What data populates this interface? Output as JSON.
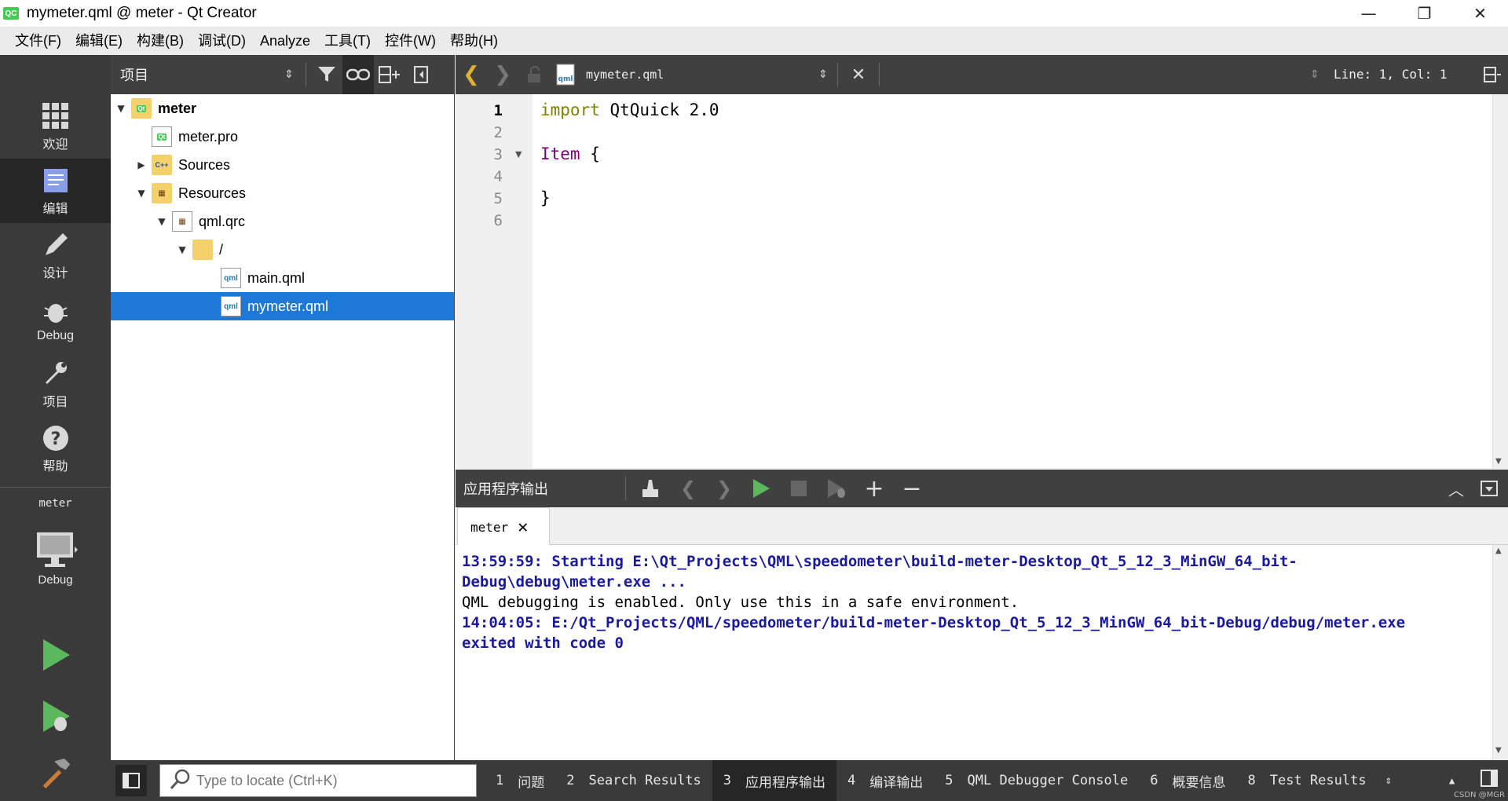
{
  "window": {
    "app_icon_text": "QC",
    "title": "mymeter.qml @ meter - Qt Creator",
    "minimize": "—",
    "restore": "❐",
    "close": "✕"
  },
  "menu": [
    "文件(F)",
    "编辑(E)",
    "构建(B)",
    "调试(D)",
    "Analyze",
    "工具(T)",
    "控件(W)",
    "帮助(H)"
  ],
  "modes": {
    "welcome": "欢迎",
    "edit": "编辑",
    "design": "设计",
    "debug": "Debug",
    "projects": "项目",
    "help": "帮助",
    "kit_name": "meter",
    "kit_mode": "Debug"
  },
  "project_panel": {
    "combo": "项目",
    "tree": [
      {
        "label": "meter",
        "bold": true
      },
      {
        "label": "meter.pro"
      },
      {
        "label": "Sources"
      },
      {
        "label": "Resources"
      },
      {
        "label": "qml.qrc"
      },
      {
        "label": "/"
      },
      {
        "label": "main.qml"
      },
      {
        "label": "mymeter.qml",
        "selected": true
      }
    ]
  },
  "editor": {
    "filename": "mymeter.qml",
    "position": "Line: 1, Col: 1",
    "line_numbers": [
      "1",
      "2",
      "3",
      "4",
      "5",
      "6"
    ],
    "code": {
      "line1_kw": "import",
      "line1_rest": " QtQuick 2.0",
      "line3_type": "Item",
      "line3_rest": " {",
      "line5": "}"
    }
  },
  "output": {
    "title": "应用程序输出",
    "tab_label": "meter",
    "lines": [
      {
        "text": "13:59:59: Starting E:\\Qt_Projects\\QML\\speedometer\\build-meter-Desktop_Qt_5_12_3_MinGW_64_bit-",
        "style": "blue"
      },
      {
        "text": "Debug\\debug\\meter.exe ...",
        "style": "blue"
      },
      {
        "text": "QML debugging is enabled. Only use this in a safe environment.",
        "style": "normal"
      },
      {
        "text": "14:04:05: E:/Qt_Projects/QML/speedometer/build-meter-Desktop_Qt_5_12_3_MinGW_64_bit-Debug/debug/meter.exe",
        "style": "blue"
      },
      {
        "text": "exited with code 0",
        "style": "blue"
      }
    ]
  },
  "statusbar": {
    "locator_placeholder": "Type to locate (Ctrl+K)",
    "panes": [
      {
        "num": "1",
        "label": "问题"
      },
      {
        "num": "2",
        "label": "Search Results"
      },
      {
        "num": "3",
        "label": "应用程序输出",
        "active": true
      },
      {
        "num": "4",
        "label": "编译输出"
      },
      {
        "num": "5",
        "label": "QML Debugger Console"
      },
      {
        "num": "6",
        "label": "概要信息"
      },
      {
        "num": "8",
        "label": "Test Results"
      }
    ],
    "watermark": "CSDN @MGR"
  }
}
